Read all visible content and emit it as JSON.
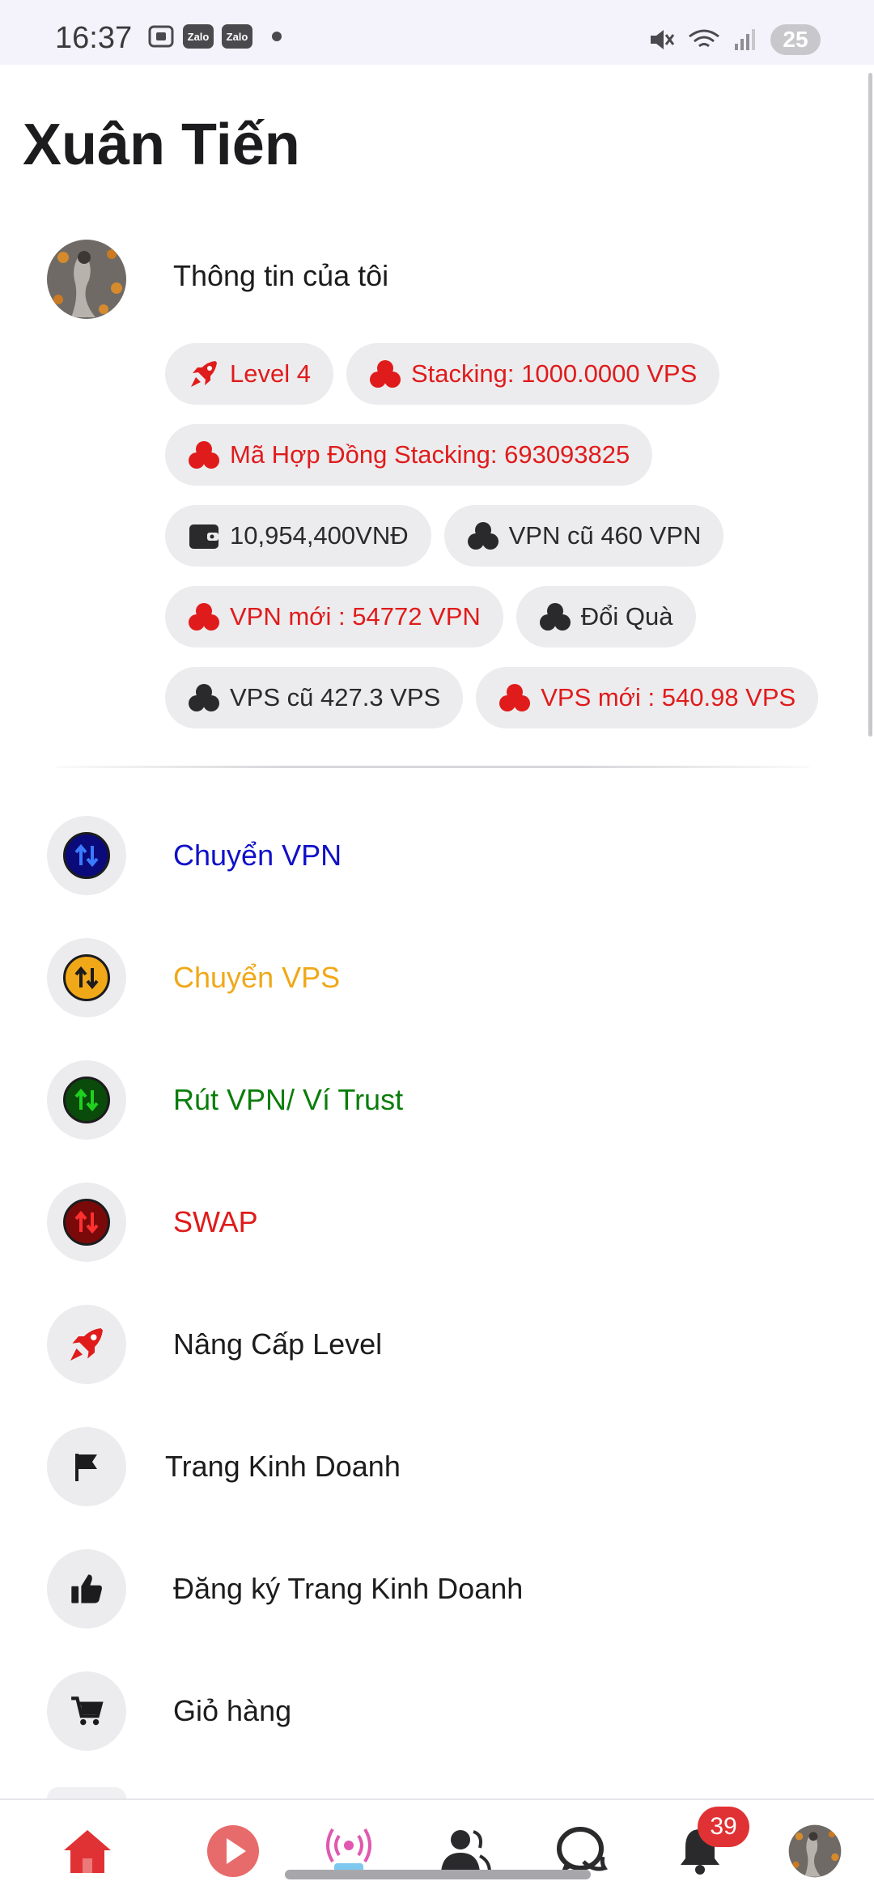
{
  "status_bar": {
    "time": "16:37",
    "app_icons": [
      "Zalo",
      "Zalo"
    ],
    "battery": "25",
    "icons": [
      "screenshot-icon",
      "mute-icon",
      "wifi-icon",
      "signal-icon"
    ]
  },
  "header": {
    "title": "Xuân Tiến"
  },
  "profile": {
    "label": "Thông tin của tôi"
  },
  "chips": [
    [
      {
        "text": "Level 4",
        "color": "red",
        "icon": "rocket-icon"
      },
      {
        "text": "Stacking: 1000.0000 VPS",
        "color": "red",
        "icon": "coins-icon"
      }
    ],
    [
      {
        "text": "Mã Hợp Đồng Stacking: 693093825",
        "color": "red",
        "icon": "coins-icon"
      }
    ],
    [
      {
        "text": "10,954,400VNĐ",
        "color": "dark",
        "icon": "wallet-icon"
      },
      {
        "text": "VPN cũ 460 VPN",
        "color": "dark",
        "icon": "coins-icon"
      }
    ],
    [
      {
        "text": "VPN mới : 54772 VPN",
        "color": "red",
        "icon": "coins-icon"
      },
      {
        "text": "Đổi Quà",
        "color": "dark",
        "icon": "coins-icon"
      }
    ],
    [
      {
        "text": "VPS cũ 427.3 VPS",
        "color": "dark",
        "icon": "coins-icon"
      },
      {
        "text": "VPS mới : 540.98 VPS",
        "color": "red",
        "icon": "coins-icon"
      }
    ]
  ],
  "menu": [
    {
      "label": "Chuyển VPN",
      "color": "#1010c8",
      "icon": "transfer-icon"
    },
    {
      "label": "Chuyển VPS",
      "color": "#f0a818",
      "icon": "transfer-icon"
    },
    {
      "label": "Rút VPN/ Ví Trust",
      "color": "#0a7d0a",
      "icon": "transfer-icon"
    },
    {
      "label": "SWAP",
      "color": "#e01b1b",
      "icon": "transfer-icon"
    },
    {
      "label": "Nâng Cấp Level",
      "color": "#1c1c1e",
      "icon": "rocket-icon"
    },
    {
      "label": "Trang Kinh Doanh",
      "color": "#1c1c1e",
      "icon": "flag-icon"
    },
    {
      "label": "Đăng ký Trang Kinh Doanh",
      "color": "#1c1c1e",
      "icon": "thumbs-up-icon"
    },
    {
      "label": "Giỏ hàng",
      "color": "#1c1c1e",
      "icon": "cart-icon"
    }
  ],
  "bottom_nav": {
    "items": [
      "home-icon",
      "play-icon",
      "live-icon",
      "friends-icon",
      "chat-icon",
      "bell-icon",
      "avatar"
    ],
    "live_label": "LIVE",
    "notification_count": "39"
  },
  "colors": {
    "red": "#e01b1b",
    "chip_bg": "#ececee",
    "brand_red": "#e03234"
  }
}
